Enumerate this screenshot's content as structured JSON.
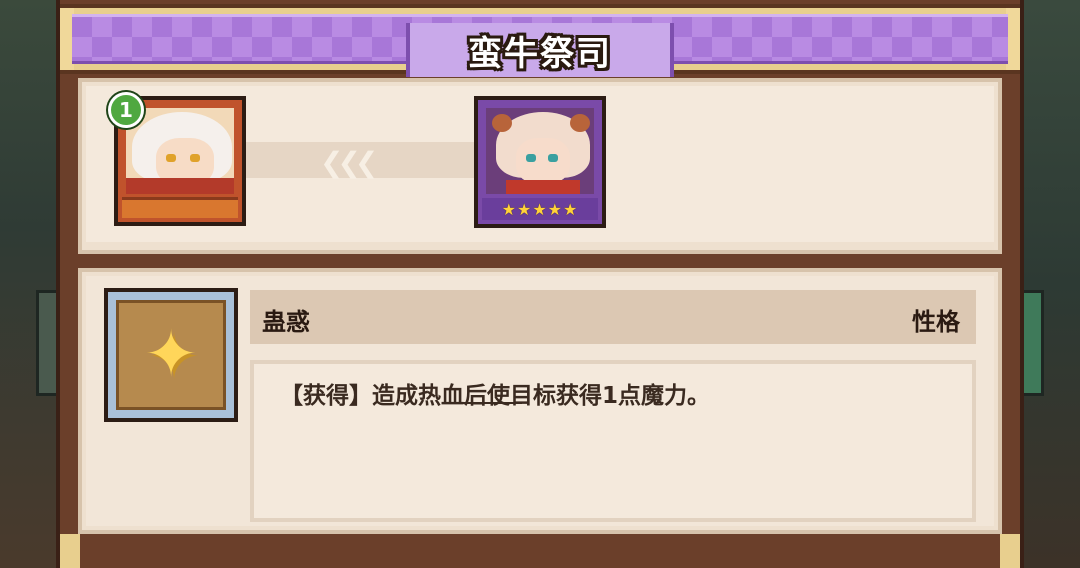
{
  "dialog": {
    "title": "蛮牛祭司"
  },
  "evolution": {
    "from_card": {
      "level_badge": "1",
      "icon": "white-haired-girl-portrait-icon"
    },
    "arrow_icon": "chevron-left-arrows-icon",
    "to_card": {
      "stars": "★★★★★",
      "icon": "horned-girl-portrait-icon"
    }
  },
  "trait": {
    "icon": "star-heart-trait-icon",
    "name": "蛊惑",
    "type": "性格",
    "description": "【获得】造成热血后使目标获得1点魔力。"
  },
  "colors": {
    "banner": "#a877d8",
    "panel": "#f2e6d8",
    "frame": "#6b3f2a",
    "badge": "#4fa840",
    "stars": "#ffd23a"
  }
}
